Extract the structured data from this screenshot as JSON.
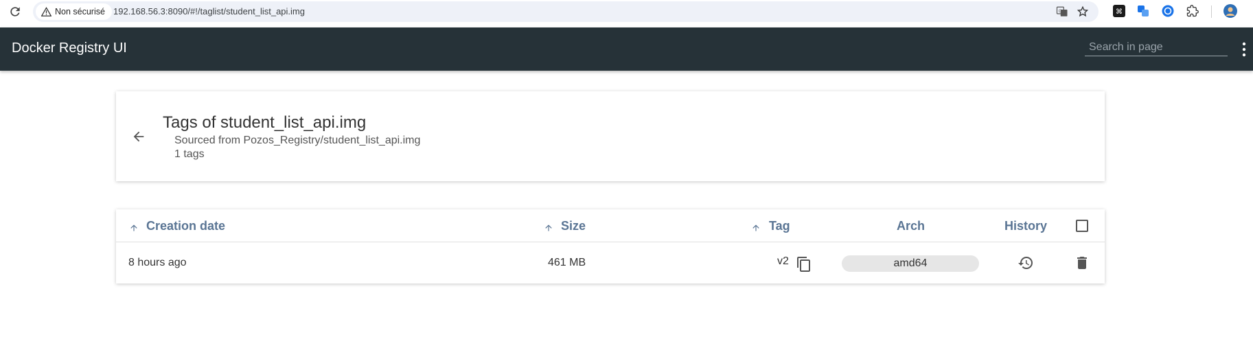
{
  "browser": {
    "security_label": "Non sécurisé",
    "url": "192.168.56.3:8090/#!/taglist/student_list_api.img"
  },
  "app": {
    "title": "Docker Registry UI",
    "search_placeholder": "Search in page"
  },
  "header": {
    "title": "Tags of student_list_api.img",
    "source": "Sourced from Pozos_Registry/student_list_api.img",
    "count": "1 tags"
  },
  "table": {
    "columns": {
      "creation_date": "Creation date",
      "size": "Size",
      "tag": "Tag",
      "arch": "Arch",
      "history": "History"
    },
    "rows": [
      {
        "creation_date": "8 hours ago",
        "size": "461 MB",
        "tag": "v2",
        "arch": "amd64"
      }
    ]
  },
  "colors": {
    "app_bar": "#263238",
    "header_text": "#5a7594"
  }
}
